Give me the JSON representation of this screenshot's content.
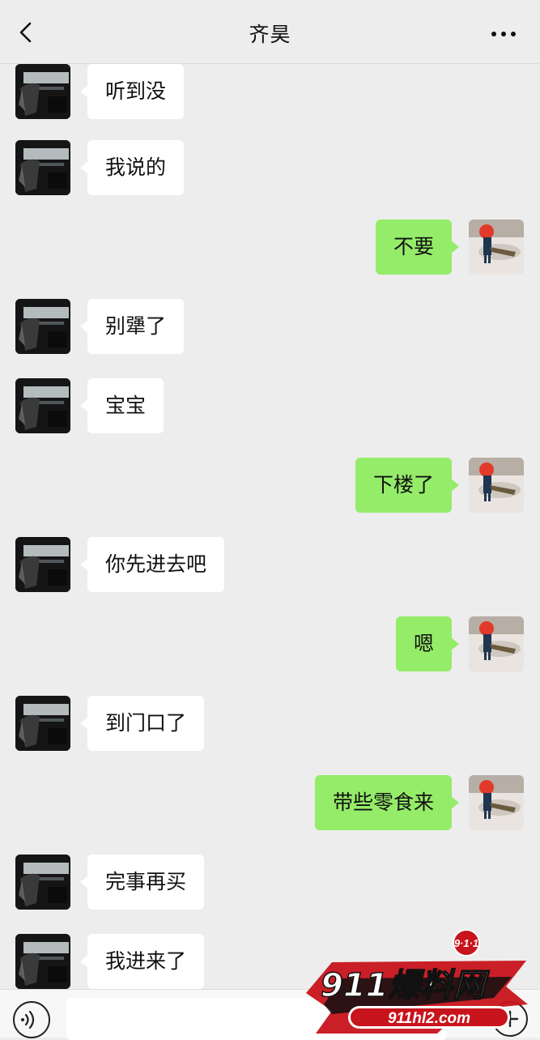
{
  "header": {
    "title": "齐昊",
    "back_icon": "chevron-left-icon",
    "more_icon": "more-dots-icon"
  },
  "messages": [
    {
      "side": "left",
      "text": "听到没"
    },
    {
      "side": "left",
      "text": "我说的"
    },
    {
      "side": "right",
      "text": "不要"
    },
    {
      "side": "left",
      "text": "别犟了"
    },
    {
      "side": "left",
      "text": "宝宝"
    },
    {
      "side": "right",
      "text": "下楼了"
    },
    {
      "side": "left",
      "text": "你先进去吧"
    },
    {
      "side": "right",
      "text": "嗯"
    },
    {
      "side": "left",
      "text": "到门口了"
    },
    {
      "side": "right",
      "text": "带些零食来"
    },
    {
      "side": "left",
      "text": "完事再买"
    },
    {
      "side": "left",
      "text": "我进来了"
    }
  ],
  "watermark": {
    "badge": "9·1·1",
    "brand": "911爆料网",
    "url": "911hl2.com"
  },
  "colors": {
    "background": "#ededed",
    "sent_bubble": "#95ec69",
    "received_bubble": "#ffffff"
  }
}
